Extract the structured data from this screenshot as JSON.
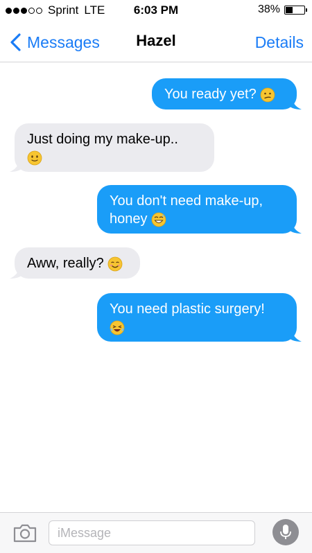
{
  "status_bar": {
    "signal_filled": 3,
    "signal_total": 5,
    "carrier": "Sprint",
    "network": "LTE",
    "time": "6:03 PM",
    "battery_percent": "38%",
    "battery_level": 0.38
  },
  "nav": {
    "back_label": "Messages",
    "title": "Hazel",
    "details_label": "Details",
    "accent_color": "#1a7cf6"
  },
  "messages": [
    {
      "direction": "sent",
      "text": "You ready yet?",
      "emoji": "confused-face-emoji"
    },
    {
      "direction": "received",
      "text": "Just doing my make-up..",
      "emoji": "slight-smile-emoji"
    },
    {
      "direction": "sent",
      "text": "You don't need make-up, honey",
      "emoji": "grinning-sweat-emoji"
    },
    {
      "direction": "received",
      "text": "Aww, really?",
      "emoji": "blushing-smile-emoji"
    },
    {
      "direction": "sent",
      "text": "You need plastic surgery!",
      "emoji": "laughing-tears-emoji"
    }
  ],
  "colors": {
    "sent_bubble": "#1a9df8",
    "received_bubble": "#ebebef"
  },
  "input_bar": {
    "placeholder": "iMessage",
    "camera_icon": "camera-icon",
    "mic_icon": "microphone-icon"
  }
}
